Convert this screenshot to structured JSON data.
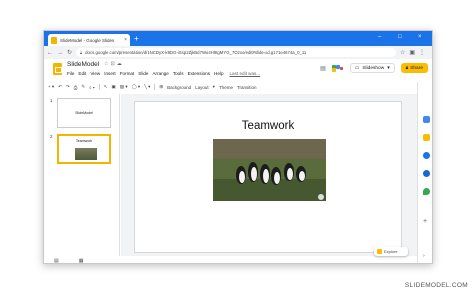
{
  "browser": {
    "tab_title": "SlideModel - Google Slides",
    "tab_close": "×",
    "new_tab": "+",
    "url": "docs.google.com/presentation/d/1NCDyX-k9DG-iSsp2ZjkBd7Wo4H9tgMYG_7Ozxo/edit#slide=id.g171e4674a_0_11",
    "min": "–",
    "max": "□",
    "close": "×"
  },
  "app": {
    "doc_title": "SlideModel",
    "menu": [
      "File",
      "Edit",
      "View",
      "Insert",
      "Format",
      "Slide",
      "Arrange",
      "Tools",
      "Extensions",
      "Help"
    ],
    "last_edit": "Last edit was...",
    "slideshow_label": "Slideshow",
    "share_label": "Share"
  },
  "toolbar": {
    "background_label": "Background",
    "layout_label": "Layout",
    "theme_label": "Theme",
    "transition_label": "Transition"
  },
  "filmstrip": {
    "slides": [
      {
        "number": "1",
        "title": "SlideModel"
      },
      {
        "number": "2",
        "title": "Teamwork"
      }
    ]
  },
  "slide": {
    "title": "Teamwork"
  },
  "explore_label": "Explore",
  "watermark": "SLIDEMODEL.COM",
  "colors": {
    "chrome_blue": "#1a73e8",
    "slides_yellow": "#f4b400",
    "share_yellow": "#fbbc04"
  }
}
